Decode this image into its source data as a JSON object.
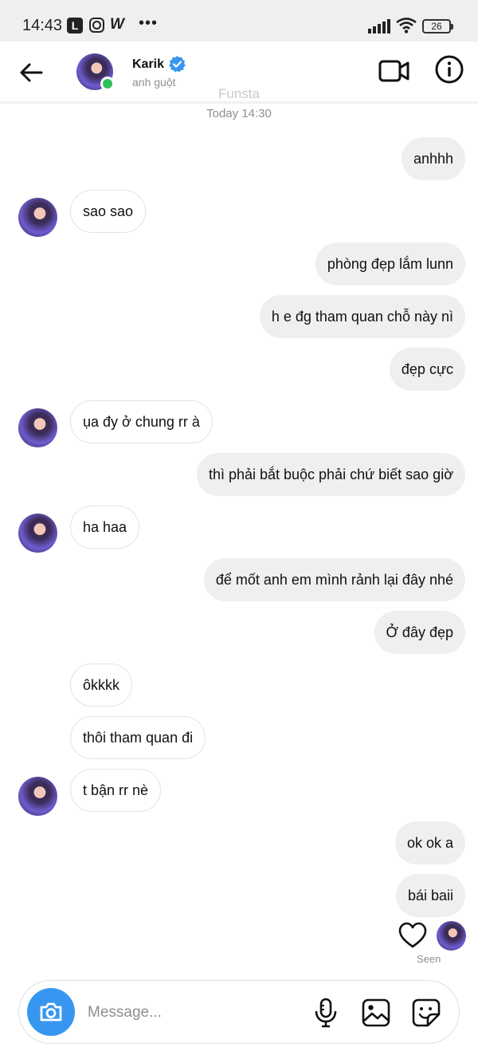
{
  "status_bar": {
    "time": "14:43",
    "app_icon_l": "L",
    "app_icon_w": "W",
    "more": "•••",
    "battery": "26",
    "icons": [
      "l-app-icon",
      "instagram-icon",
      "w-app-icon",
      "more-dots-icon",
      "signal-icon",
      "wifi-icon",
      "battery-icon"
    ]
  },
  "header": {
    "contact_name": "Karik",
    "contact_subtitle": "anh guột",
    "watermark": "Funsta",
    "verified": true,
    "online": true,
    "online_color": "#2ec05a",
    "verified_color": "#3797f0"
  },
  "timestamp": "Today 14:30",
  "messages": [
    {
      "side": "sent",
      "text": "anhhh"
    },
    {
      "side": "recv",
      "text": "sao sao",
      "avatar": true
    },
    {
      "side": "sent",
      "text": "phòng đẹp lắm lunn"
    },
    {
      "side": "sent",
      "text": "h e đg tham quan chỗ này nì"
    },
    {
      "side": "sent",
      "text": "đẹp cực"
    },
    {
      "side": "recv",
      "text": "ụa đy ở chung rr à",
      "avatar": true
    },
    {
      "side": "sent",
      "text": "thì phải bắt buộc phải chứ biết sao giờ"
    },
    {
      "side": "recv",
      "text": "ha haa",
      "avatar": true
    },
    {
      "side": "sent",
      "text": "để mốt anh em mình rảnh lại đây nhé"
    },
    {
      "side": "sent",
      "text": "Ở đây đẹp"
    },
    {
      "side": "recv",
      "text": "ôkkkk",
      "avatar": false
    },
    {
      "side": "recv",
      "text": "thôi tham quan đi",
      "avatar": false
    },
    {
      "side": "recv",
      "text": "t bận rr nè",
      "avatar": true
    },
    {
      "side": "sent",
      "text": "ok ok a"
    },
    {
      "side": "sent",
      "text": "bái baii"
    }
  ],
  "seen_label": "Seen",
  "composer": {
    "placeholder": "Message...",
    "value": "",
    "camera_color": "#3797f0"
  },
  "colors": {
    "sent_bubble": "#efefef",
    "recv_bubble_border": "#e3e3e3",
    "accent": "#3797f0"
  }
}
